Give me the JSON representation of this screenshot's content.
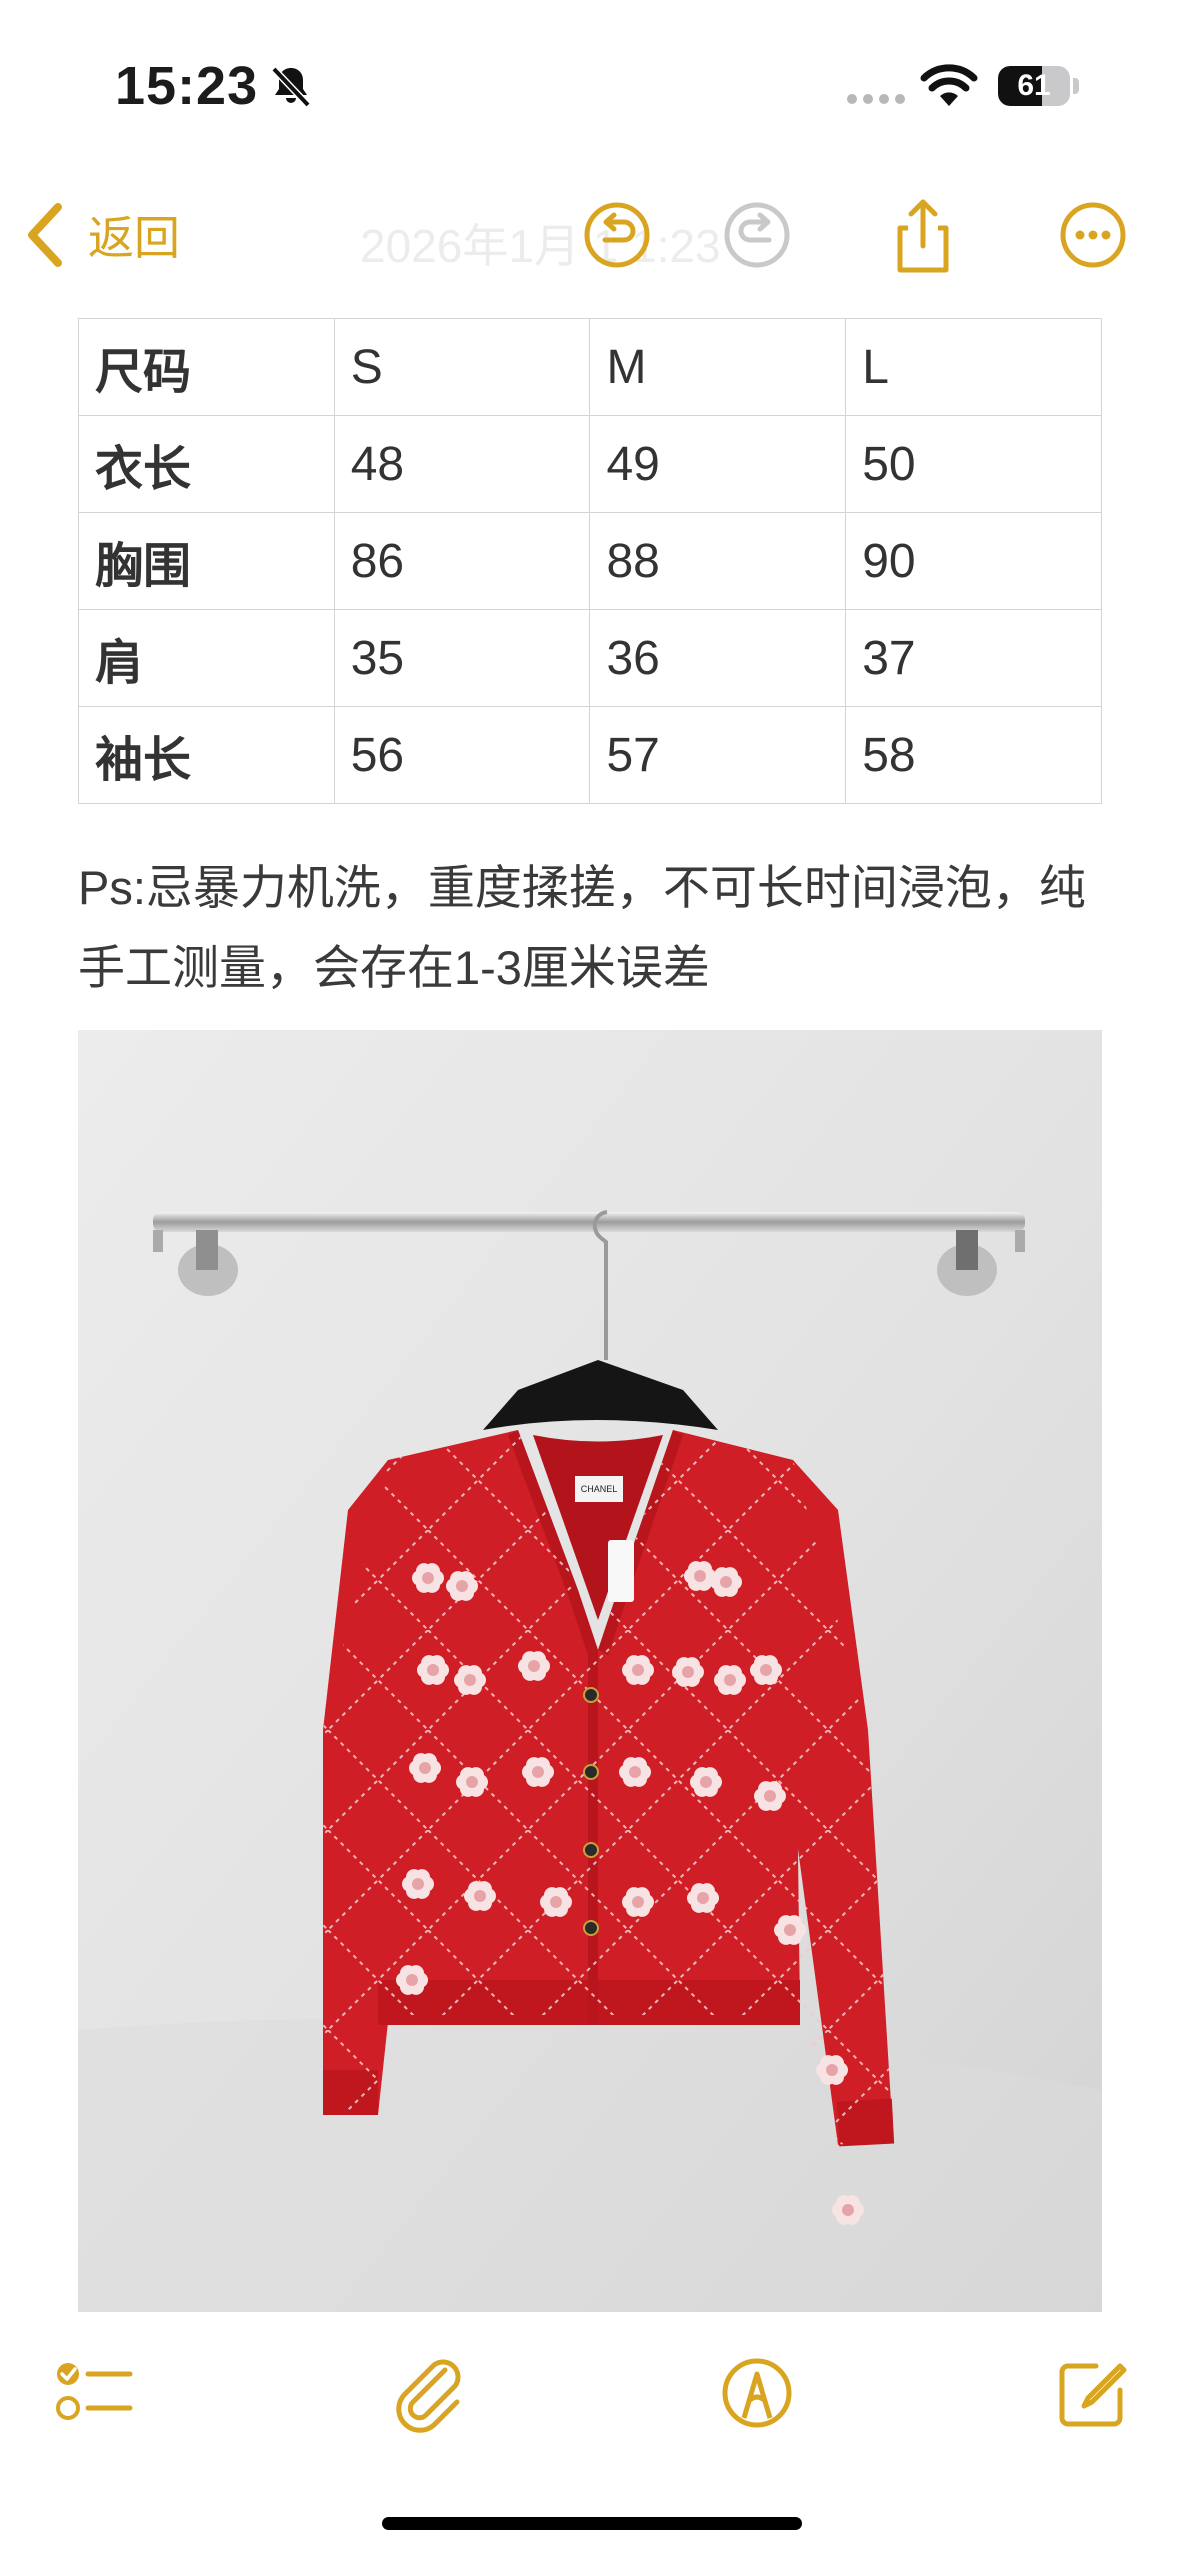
{
  "status": {
    "time": "15:23",
    "battery": "61",
    "battery_level": 0.61
  },
  "nav": {
    "back_label": "返回",
    "title": "2026年1月 1 1:23",
    "accent": "#d9a520"
  },
  "size_table": {
    "rows": [
      [
        "尺码",
        "S",
        "M",
        "L"
      ],
      [
        "衣长",
        "48",
        "49",
        "50"
      ],
      [
        "胸围",
        "86",
        "88",
        "90"
      ],
      [
        "肩",
        "35",
        "36",
        "37"
      ],
      [
        "袖长",
        "56",
        "57",
        "58"
      ]
    ]
  },
  "note": "Ps:忌暴力机洗，重度揉搓，不可长时间浸泡，纯手工测量，会存在1-3厘米误差",
  "photo": {
    "label_text": "CHANEL",
    "garment_color": "#cf1e25"
  },
  "icons": {
    "back": "chevron-left-icon",
    "undo": "undo-icon",
    "redo": "redo-icon",
    "share": "share-icon",
    "more": "more-icon",
    "checklist": "checklist-icon",
    "attach": "paperclip-icon",
    "markup": "markup-pen-icon",
    "compose": "compose-icon"
  }
}
